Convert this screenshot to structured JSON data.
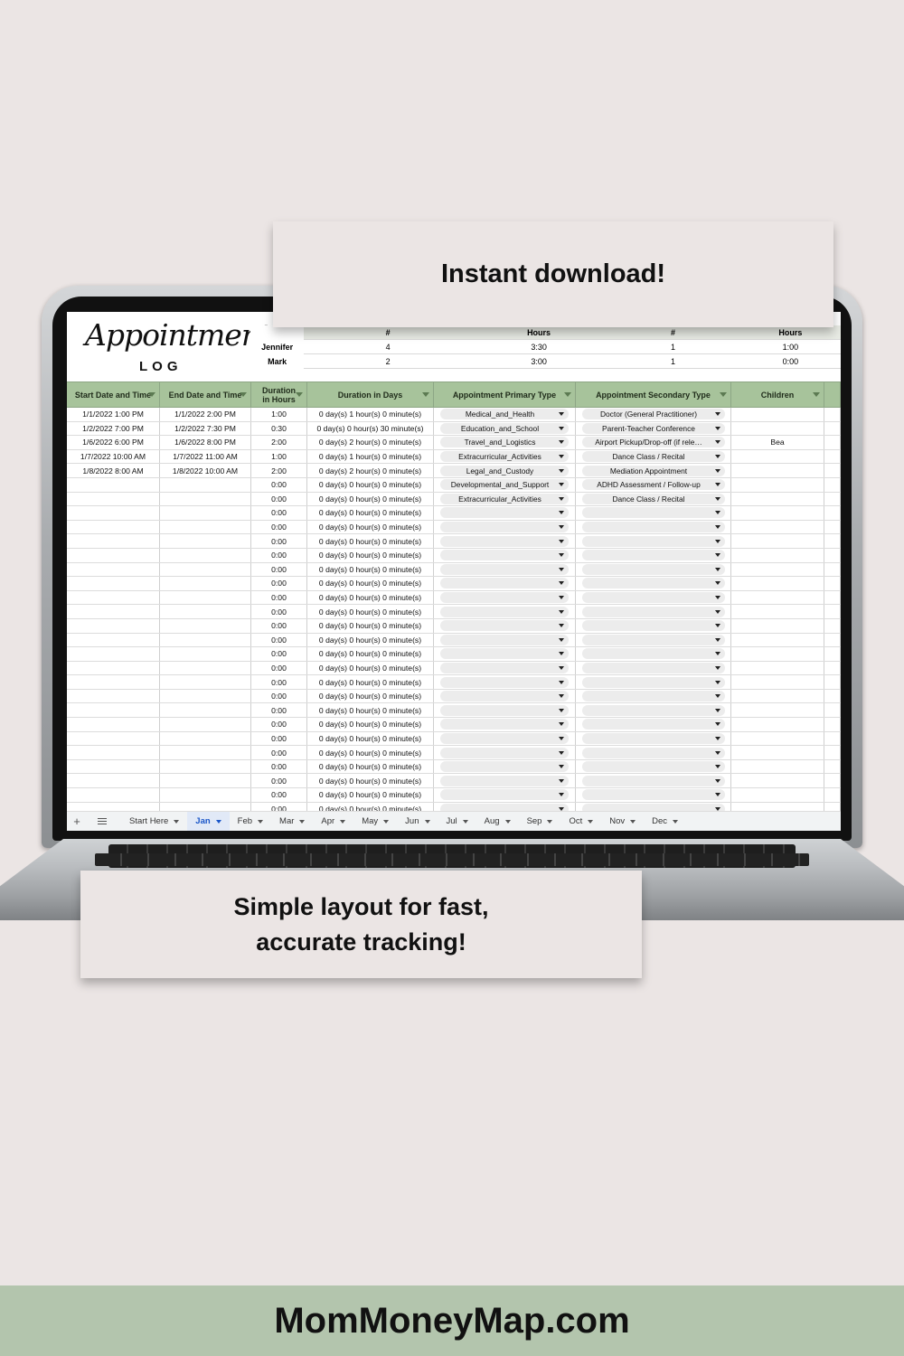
{
  "callouts": {
    "top": "Instant download!",
    "bottom_line1": "Simple layout for fast,",
    "bottom_line2": "accurate tracking!"
  },
  "footer": {
    "site": "MomMoneyMap.com"
  },
  "sheet": {
    "title_script": "Appointment",
    "title_sub": "LOG",
    "summary": {
      "headers": [
        "#",
        "Hours",
        "#",
        "Hours"
      ],
      "rows": [
        {
          "name": "Jennifer",
          "values": [
            "4",
            "3:30",
            "1",
            "1:00"
          ]
        },
        {
          "name": "Mark",
          "values": [
            "2",
            "3:00",
            "1",
            "0:00"
          ]
        }
      ]
    },
    "columns": [
      "Start Date and Time",
      "End Date and Time",
      "Duration in Hours",
      "Duration in Days",
      "Appointment  Primary Type",
      "Appointment Secondary Type",
      "Children"
    ],
    "rows": [
      [
        "1/1/2022 1:00 PM",
        "1/1/2022 2:00 PM",
        "1:00",
        "0 day(s) 1 hour(s) 0 minute(s)",
        "Medical_and_Health",
        "Doctor (General Practitioner)",
        ""
      ],
      [
        "1/2/2022 7:00 PM",
        "1/2/2022 7:30 PM",
        "0:30",
        "0 day(s) 0 hour(s) 30 minute(s)",
        "Education_and_School",
        "Parent-Teacher Conference",
        ""
      ],
      [
        "1/6/2022 6:00 PM",
        "1/6/2022 8:00 PM",
        "2:00",
        "0 day(s) 2 hour(s) 0 minute(s)",
        "Travel_and_Logistics",
        "Airport Pickup/Drop-off (if rele…",
        "Bea"
      ],
      [
        "1/7/2022 10:00 AM",
        "1/7/2022 11:00 AM",
        "1:00",
        "0 day(s) 1 hour(s) 0 minute(s)",
        "Extracurricular_Activities",
        "Dance Class / Recital",
        ""
      ],
      [
        "1/8/2022 8:00 AM",
        "1/8/2022 10:00 AM",
        "2:00",
        "0 day(s) 2 hour(s) 0 minute(s)",
        "Legal_and_Custody",
        "Mediation Appointment",
        ""
      ],
      [
        "",
        "",
        "0:00",
        "0 day(s) 0 hour(s) 0 minute(s)",
        "Developmental_and_Support",
        "ADHD Assessment / Follow-up",
        ""
      ],
      [
        "",
        "",
        "0:00",
        "0 day(s) 0 hour(s) 0 minute(s)",
        "Extracurricular_Activities",
        "Dance Class / Recital",
        ""
      ],
      [
        "",
        "",
        "0:00",
        "0 day(s) 0 hour(s) 0 minute(s)",
        "",
        "",
        ""
      ],
      [
        "",
        "",
        "0:00",
        "0 day(s) 0 hour(s) 0 minute(s)",
        "",
        "",
        ""
      ],
      [
        "",
        "",
        "0:00",
        "0 day(s) 0 hour(s) 0 minute(s)",
        "",
        "",
        ""
      ],
      [
        "",
        "",
        "0:00",
        "0 day(s) 0 hour(s) 0 minute(s)",
        "",
        "",
        ""
      ],
      [
        "",
        "",
        "0:00",
        "0 day(s) 0 hour(s) 0 minute(s)",
        "",
        "",
        ""
      ],
      [
        "",
        "",
        "0:00",
        "0 day(s) 0 hour(s) 0 minute(s)",
        "",
        "",
        ""
      ],
      [
        "",
        "",
        "0:00",
        "0 day(s) 0 hour(s) 0 minute(s)",
        "",
        "",
        ""
      ],
      [
        "",
        "",
        "0:00",
        "0 day(s) 0 hour(s) 0 minute(s)",
        "",
        "",
        ""
      ],
      [
        "",
        "",
        "0:00",
        "0 day(s) 0 hour(s) 0 minute(s)",
        "",
        "",
        ""
      ],
      [
        "",
        "",
        "0:00",
        "0 day(s) 0 hour(s) 0 minute(s)",
        "",
        "",
        ""
      ],
      [
        "",
        "",
        "0:00",
        "0 day(s) 0 hour(s) 0 minute(s)",
        "",
        "",
        ""
      ],
      [
        "",
        "",
        "0:00",
        "0 day(s) 0 hour(s) 0 minute(s)",
        "",
        "",
        ""
      ],
      [
        "",
        "",
        "0:00",
        "0 day(s) 0 hour(s) 0 minute(s)",
        "",
        "",
        ""
      ],
      [
        "",
        "",
        "0:00",
        "0 day(s) 0 hour(s) 0 minute(s)",
        "",
        "",
        ""
      ],
      [
        "",
        "",
        "0:00",
        "0 day(s) 0 hour(s) 0 minute(s)",
        "",
        "",
        ""
      ],
      [
        "",
        "",
        "0:00",
        "0 day(s) 0 hour(s) 0 minute(s)",
        "",
        "",
        ""
      ],
      [
        "",
        "",
        "0:00",
        "0 day(s) 0 hour(s) 0 minute(s)",
        "",
        "",
        ""
      ],
      [
        "",
        "",
        "0:00",
        "0 day(s) 0 hour(s) 0 minute(s)",
        "",
        "",
        ""
      ],
      [
        "",
        "",
        "0:00",
        "0 day(s) 0 hour(s) 0 minute(s)",
        "",
        "",
        ""
      ],
      [
        "",
        "",
        "0:00",
        "0 day(s) 0 hour(s) 0 minute(s)",
        "",
        "",
        ""
      ],
      [
        "",
        "",
        "0:00",
        "0 day(s) 0 hour(s) 0 minute(s)",
        "",
        "",
        ""
      ],
      [
        "",
        "",
        "0:00",
        "0 day(s) 0 hour(s) 0 minute(s)",
        "",
        "",
        ""
      ]
    ],
    "tabs": [
      "Start Here",
      "Jan",
      "Feb",
      "Mar",
      "Apr",
      "May",
      "Jun",
      "Jul",
      "Aug",
      "Sep",
      "Oct",
      "Nov",
      "Dec"
    ],
    "active_tab": "Jan",
    "colors": {
      "header_green": "#a7c39b",
      "footer_green": "#b3c5ad",
      "background": "#ebe5e4",
      "active_tab": "#1a56c9"
    }
  }
}
